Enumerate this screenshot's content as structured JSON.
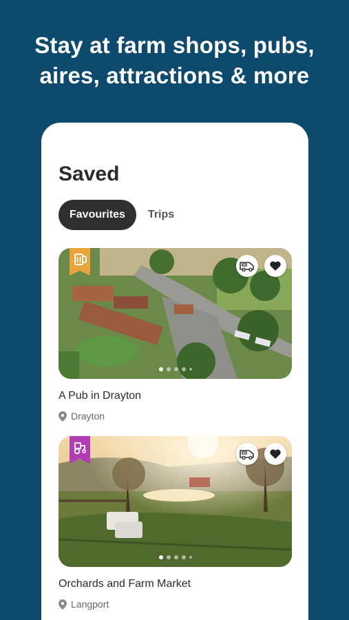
{
  "headline": {
    "line1": "Stay at farm shops, pubs,",
    "line2": "aires, attractions  & more"
  },
  "saved": {
    "title": "Saved",
    "tabs": [
      {
        "label": "Favourites",
        "active": true
      },
      {
        "label": "Trips",
        "active": false
      }
    ]
  },
  "listings": [
    {
      "name": "A Pub in Drayton",
      "location": "Drayton",
      "category_icon": "pub-icon",
      "category_color": "#e8a33b",
      "actions": [
        "campervan-icon",
        "heart-icon"
      ]
    },
    {
      "name": "Orchards and Farm Market",
      "location": "Langport",
      "category_icon": "tractor-icon",
      "category_color": "#b23cb4",
      "actions": [
        "campervan-icon",
        "heart-icon"
      ]
    }
  ],
  "colors": {
    "background": "#0d4a6e",
    "card": "#ffffff",
    "active_tab": "#2f2f2f"
  }
}
